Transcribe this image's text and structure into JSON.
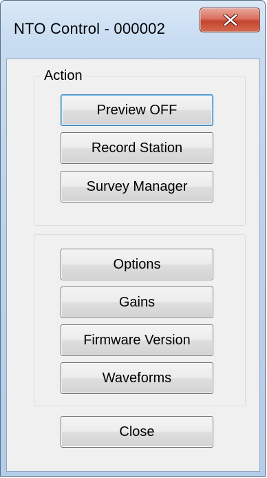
{
  "window": {
    "title": "NTO Control - 000002"
  },
  "action_group": {
    "legend": "Action",
    "buttons": [
      {
        "label": "Preview OFF"
      },
      {
        "label": "Record Station"
      },
      {
        "label": "Survey Manager"
      }
    ]
  },
  "settings_group": {
    "buttons": [
      {
        "label": "Options"
      },
      {
        "label": "Gains"
      },
      {
        "label": "Firmware Version"
      },
      {
        "label": "Waveforms"
      }
    ]
  },
  "footer": {
    "close_label": "Close"
  },
  "colors": {
    "titlebar": "#c8dcf1",
    "close_button": "#c4452f",
    "client_bg": "#f0f0f0",
    "default_button_border": "#3c7fb1"
  },
  "icons": {
    "title_close": "close-icon"
  }
}
